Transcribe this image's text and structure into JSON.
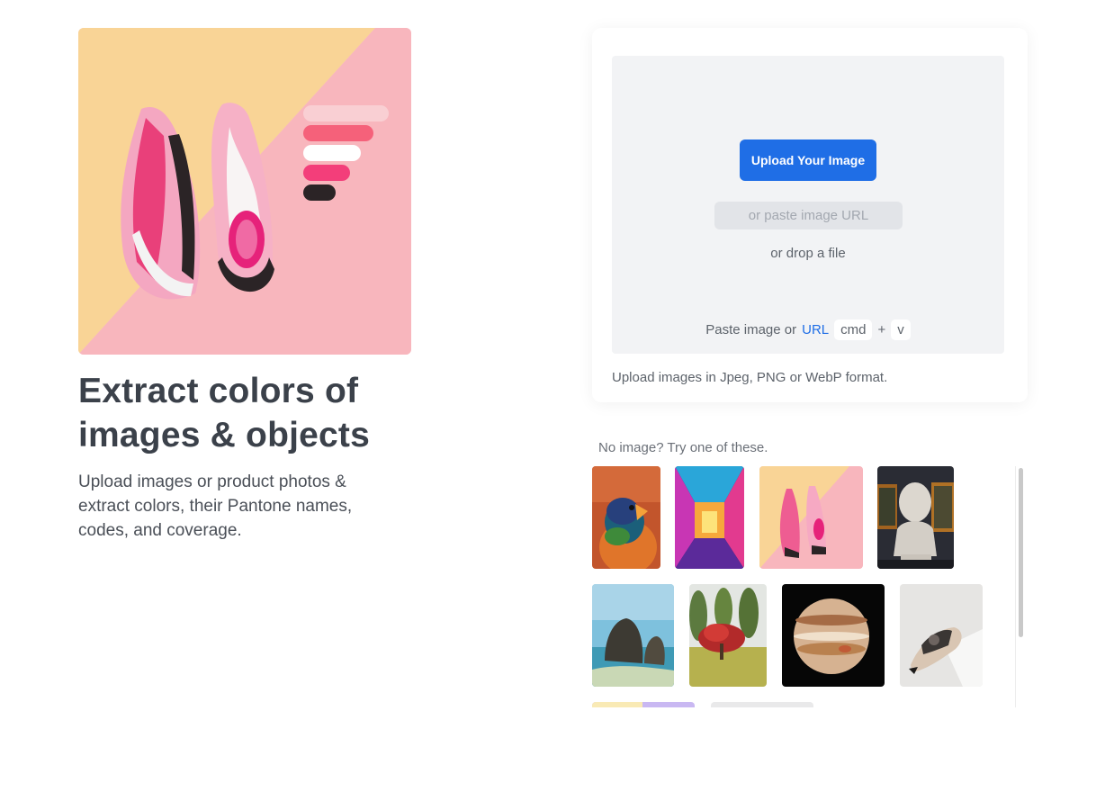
{
  "hero": {
    "image_icon": "sneakers-photo",
    "title_line1": "Extract colors of",
    "title_line2": "images & objects",
    "subtitle": "Upload images or product photos & extract colors, their Pantone names, codes, and coverage."
  },
  "upload": {
    "button_label": "Upload Your Image",
    "url_placeholder": "or paste image URL",
    "drop_text": "or drop a file",
    "paste_prefix": "Paste image or",
    "paste_url_link": "URL",
    "key_cmd": "cmd",
    "key_plus": "+",
    "key_v": "v",
    "format_note": "Upload images in Jpeg, PNG or WebP format."
  },
  "samples": {
    "label": "No image? Try one of these.",
    "items": [
      {
        "name": "parrot"
      },
      {
        "name": "neon-corridor"
      },
      {
        "name": "sneakers"
      },
      {
        "name": "sculpture"
      },
      {
        "name": "sea-rocks"
      },
      {
        "name": "red-tree"
      },
      {
        "name": "jupiter"
      },
      {
        "name": "shoe"
      },
      {
        "name": "pastel"
      },
      {
        "name": "gray"
      }
    ]
  },
  "colors": {
    "accent": "#1f6ee6",
    "drop_zone_bg": "#f2f3f5",
    "text_dark": "#3b414a"
  }
}
